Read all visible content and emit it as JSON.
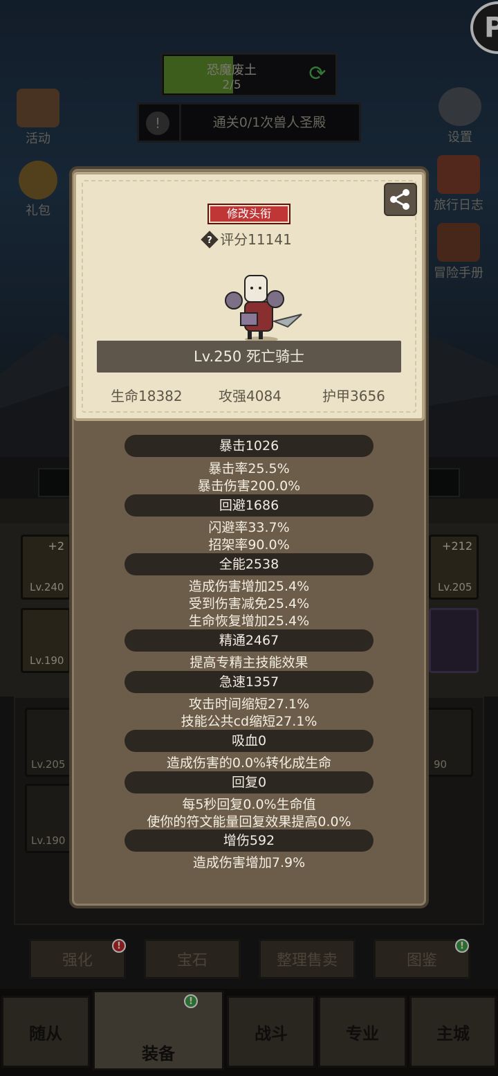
{
  "hud": {
    "zone_name": "恐魔废土",
    "zone_progress": "2/5",
    "zone_progress_fraction": 0.4,
    "mission_text": "通关0/1次兽人圣殿"
  },
  "side_menu_left": {
    "activity": "活动",
    "gift": "礼包"
  },
  "side_menu_right": {
    "settings": "设置",
    "travel_log": "旅行日志",
    "adventure_manual": "冒险手册"
  },
  "profile": {
    "rename_button": "修改头衔",
    "score": "评分11141",
    "name_line": "Lv.250 死亡骑士",
    "hp": "生命18382",
    "attack": "攻强4084",
    "armor": "护甲3656"
  },
  "stats": [
    {
      "header": "暴击1026",
      "lines": [
        "暴击率25.5%",
        "暴击伤害200.0%"
      ]
    },
    {
      "header": "回避1686",
      "lines": [
        "闪避率33.7%",
        "招架率90.0%"
      ]
    },
    {
      "header": "全能2538",
      "lines": [
        "造成伤害增加25.4%",
        "受到伤害减免25.4%",
        "生命恢复增加25.4%"
      ]
    },
    {
      "header": "精通2467",
      "lines": [
        "提高专精主技能效果"
      ]
    },
    {
      "header": "急速1357",
      "lines": [
        "攻击时间缩短27.1%",
        "技能公共cd缩短27.1%"
      ]
    },
    {
      "header": "吸血0",
      "lines": [
        "造成伤害的0.0%转化成生命"
      ]
    },
    {
      "header": "回复0",
      "lines": [
        "每5秒回复0.0%生命值",
        "使你的符文能量回复效果提高0.0%"
      ]
    },
    {
      "header": "增伤592",
      "lines": [
        "造成伤害增加7.9%"
      ]
    }
  ],
  "equipment_slots": {
    "slot1_plus": "+2",
    "slot1_level": "Lv.240",
    "slot2_level": "Lv.190",
    "slot3_plus": "+212",
    "slot3_level": "Lv.205",
    "slot4_level": "Lv.205",
    "slot5_level": "Lv.190",
    "slot6_level": "90"
  },
  "action_buttons": {
    "enhance": "强化",
    "gem": "宝石",
    "sort_sell": "整理售卖",
    "codex": "图鉴",
    "enhance_badge": "!",
    "codex_badge": "!"
  },
  "bottom_nav": {
    "follower": "随从",
    "equipment": "装备",
    "battle": "战斗",
    "profession": "专业",
    "main_city": "主城",
    "equipment_badge": "!"
  },
  "colors": {
    "popup_bg": "#6b5d49",
    "card_bg": "#ece2c8",
    "rename_red": "#c03535",
    "progress_green": "#5a8a2a",
    "stat_header_bg": "#2c2721"
  }
}
